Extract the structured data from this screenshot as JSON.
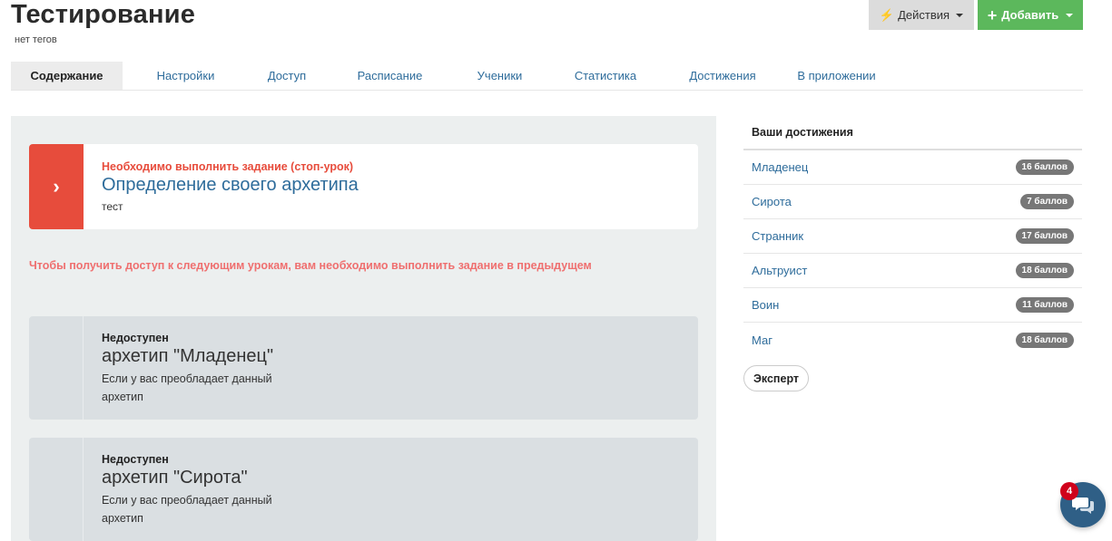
{
  "header": {
    "title": "Тестирование",
    "tags": "нет тегов",
    "actions_label": "Действия",
    "add_label": "Добавить",
    "accent_add": "#5cb85c"
  },
  "tabs": [
    {
      "label": "Содержание",
      "active": true
    },
    {
      "label": "Настройки",
      "active": false
    },
    {
      "label": "Доступ",
      "active": false
    },
    {
      "label": "Расписание",
      "active": false
    },
    {
      "label": "Ученики",
      "active": false
    },
    {
      "label": "Статистика",
      "active": false
    },
    {
      "label": "Достижения",
      "active": false
    },
    {
      "label": "В приложении",
      "active": false
    }
  ],
  "stop_lesson": {
    "label": "Необходимо выполнить задание (стоп-урок)",
    "title": "Определение своего архетипа",
    "subtitle": "тест",
    "arrow_icon": "chevron-right-icon",
    "color": "#e74c3c"
  },
  "warning": "Чтобы получить доступ к следующим урокам, вам необходимо выполнить задание в предыдущем",
  "lessons": [
    {
      "status": "Недоступен",
      "title": "архетип \"Младенец\"",
      "description": "Если у вас преобладает данный архетип"
    },
    {
      "status": "Недоступен",
      "title": "архетип \"Сирота\"",
      "description": "Если у вас преобладает данный архетип"
    }
  ],
  "achievements": {
    "header": "Ваши достижения",
    "items": [
      {
        "name": "Младенец",
        "points": "16 баллов"
      },
      {
        "name": "Сирота",
        "points": "7 баллов"
      },
      {
        "name": "Странник",
        "points": "17 баллов"
      },
      {
        "name": "Альтруист",
        "points": "18 баллов"
      },
      {
        "name": "Воин",
        "points": "11 баллов"
      },
      {
        "name": "Маг",
        "points": "18 баллов"
      }
    ],
    "expert_label": "Эксперт"
  },
  "chat": {
    "count": "4",
    "icon": "chat-bubble-icon"
  }
}
